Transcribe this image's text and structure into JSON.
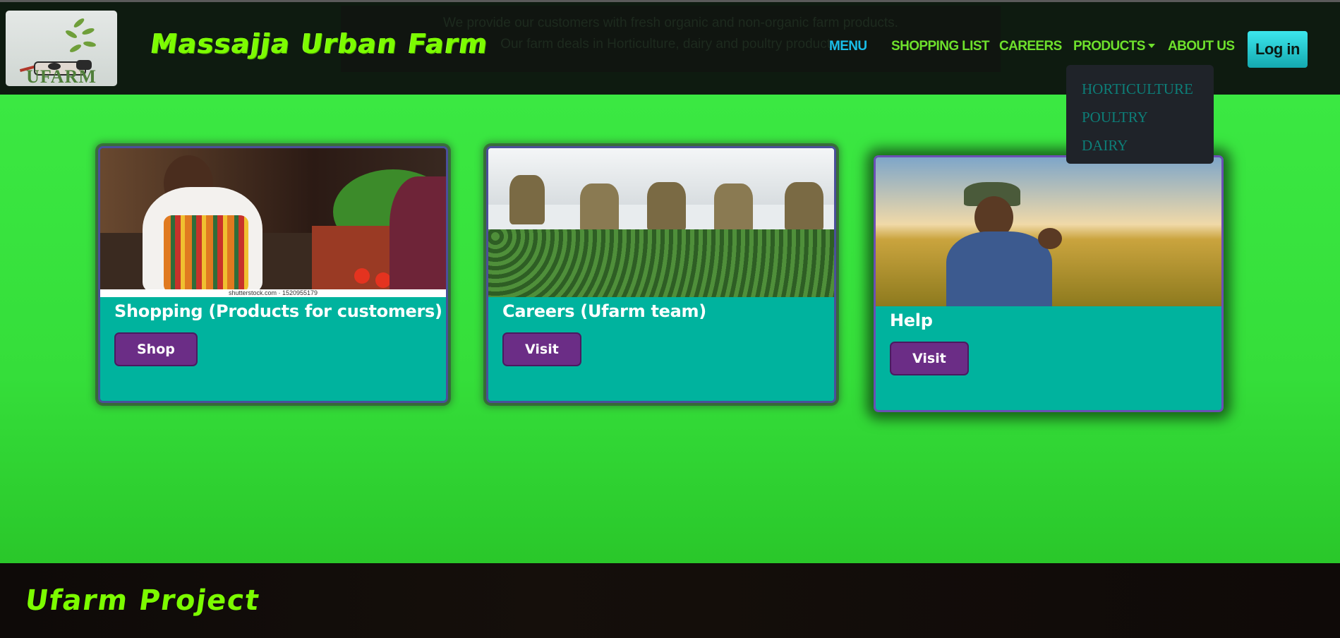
{
  "header": {
    "logo_text": "UFARM",
    "site_title": "Massajja Urban Farm",
    "banner_lines": [
      "We provide our customers with fresh organic and non-organic farm products.",
      "Our farm deals in Horticulture, dairy and poultry products."
    ]
  },
  "nav": {
    "menu": "MENU",
    "shopping_list": "SHOPPING LIST",
    "careers": "CAREERS",
    "products": "PRODUCTS",
    "about_us": "ABOUT US",
    "login": "Log in"
  },
  "dropdown": {
    "items": [
      "HORTICULTURE",
      "POULTRY",
      "DAIRY"
    ]
  },
  "cards": [
    {
      "title": "Shopping (Products for customers)",
      "button": "Shop",
      "image_caption": "shutterstock.com · 1520955179"
    },
    {
      "title": "Careers (Ufarm team)",
      "button": "Visit"
    },
    {
      "title": "Help",
      "button": "Visit"
    }
  ],
  "footer": {
    "title": "Ufarm Project"
  },
  "colors": {
    "accent_green": "#7cfc00",
    "card_bg": "#00b39e",
    "button_purple": "#6b2d86",
    "nav_active": "#19bde8"
  }
}
